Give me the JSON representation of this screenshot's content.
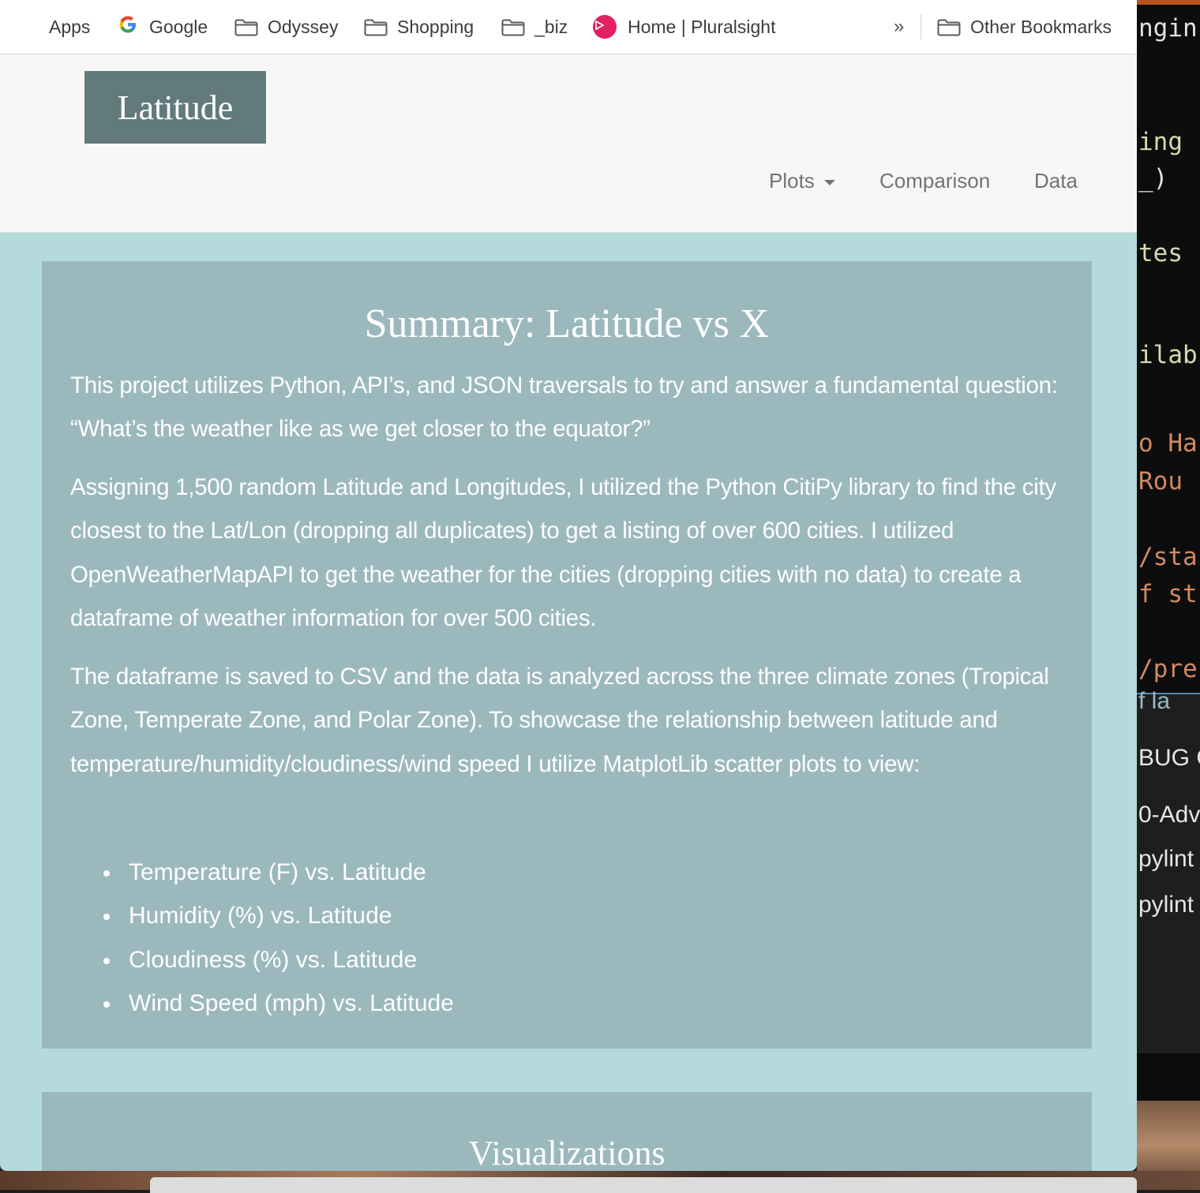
{
  "bookmarks": {
    "items": [
      {
        "label": "Apps",
        "icon": "apps-grid-icon"
      },
      {
        "label": "Google",
        "icon": "google-icon"
      },
      {
        "label": "Odyssey",
        "icon": "folder-icon"
      },
      {
        "label": "Shopping",
        "icon": "folder-icon"
      },
      {
        "label": "_biz",
        "icon": "folder-icon"
      },
      {
        "label": "Home | Pluralsight",
        "icon": "pluralsight-icon"
      }
    ],
    "overflow": "»",
    "other": "Other Bookmarks"
  },
  "site": {
    "brand": "Latitude",
    "nav": {
      "plots": "Plots",
      "comparison": "Comparison",
      "data": "Data"
    }
  },
  "summary": {
    "title": "Summary: Latitude vs X",
    "p1": "This project utilizes Python, API’s, and JSON traversals to try and answer a fundamental question: “What’s the weather like as we get closer to the equator?”",
    "p2": "Assigning 1,500 random Latitude and Longitudes, I utilized the Python CitiPy library to find the city closest to the Lat/Lon (dropping all duplicates) to get a listing of over 600 cities. I utilized OpenWeatherMapAPI to get the weather for the cities (dropping cities with no data) to create a dataframe of weather information for over 500 cities.",
    "p3": "The dataframe is saved to CSV and the data is analyzed across the three climate zones (Tropical Zone, Temperate Zone, and Polar Zone). To showcase the relationship between latitude and temperature/humidity/cloudiness/wind speed I utilize MatplotLib scatter plots to view:",
    "bullets": [
      "Temperature (F) vs. Latitude",
      "Humidity (%) vs. Latitude",
      "Cloudiness (%) vs. Latitude",
      "Wind Speed (mph) vs. Latitude"
    ]
  },
  "visualizations": {
    "title": "Visualizations"
  },
  "editor": {
    "lines": [
      "ngin",
      "ing",
      "_)",
      "tes",
      "ilab",
      "o Ha",
      " Rou",
      "/sta",
      "f st",
      "/pre",
      "f la"
    ],
    "panel_lines": [
      "BUG C",
      "0-Adv",
      "pylint",
      "pylint"
    ]
  },
  "colors": {
    "page_bg": "#b5dadb",
    "panel_bg": "#9bb8bd",
    "brand_bg": "#627a7b",
    "navbar_bg": "#f7f7f7",
    "nav_text": "#737373",
    "pluralsight": "#e2215f"
  }
}
